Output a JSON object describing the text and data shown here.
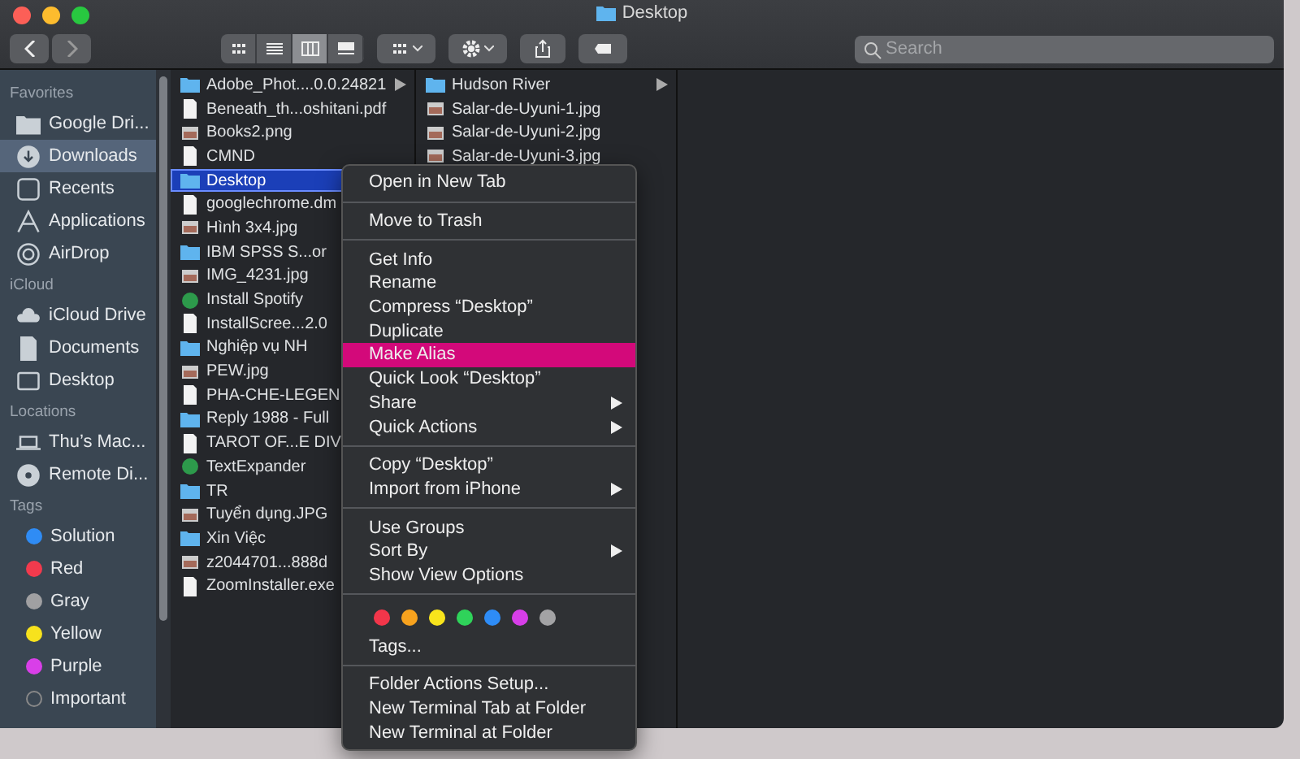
{
  "window": {
    "title": "Desktop"
  },
  "toolbar": {
    "views": [
      {
        "kind": "icons",
        "selected": false
      },
      {
        "kind": "list",
        "selected": false
      },
      {
        "kind": "columns",
        "selected": true
      },
      {
        "kind": "gallery",
        "selected": false
      }
    ],
    "search": {
      "placeholder": "Search"
    }
  },
  "sidebar": {
    "sections": [
      {
        "title": "Favorites",
        "items": [
          {
            "label": "Google Dri...",
            "kind": "folder",
            "selected": false
          },
          {
            "label": "Downloads",
            "kind": "download",
            "selected": true
          },
          {
            "label": "Recents",
            "kind": "recents",
            "selected": false
          },
          {
            "label": "Applications",
            "kind": "apps",
            "selected": false
          },
          {
            "label": "AirDrop",
            "kind": "airdrop",
            "selected": false
          }
        ]
      },
      {
        "title": "iCloud",
        "items": [
          {
            "label": "iCloud Drive",
            "kind": "cloud",
            "selected": false
          },
          {
            "label": "Documents",
            "kind": "document",
            "selected": false
          },
          {
            "label": "Desktop",
            "kind": "desktop",
            "selected": false
          }
        ]
      },
      {
        "title": "Locations",
        "items": [
          {
            "label": "Thu’s Mac...",
            "kind": "laptop",
            "selected": false
          },
          {
            "label": "Remote Di...",
            "kind": "disc",
            "selected": false
          }
        ]
      },
      {
        "title": "Tags",
        "items": [
          {
            "label": "Solution",
            "kind": "tag",
            "color": "#2f8cf5",
            "selected": false
          },
          {
            "label": "Red",
            "kind": "tag",
            "color": "#f23a4d",
            "selected": false
          },
          {
            "label": "Gray",
            "kind": "tag",
            "color": "#a0a0a2",
            "selected": false
          },
          {
            "label": "Yellow",
            "kind": "tag",
            "color": "#f7e21d",
            "selected": false
          },
          {
            "label": "Purple",
            "kind": "tag",
            "color": "#d93fe8",
            "selected": false
          },
          {
            "label": "Important",
            "kind": "tag-empty",
            "selected": false
          }
        ]
      }
    ]
  },
  "columns": [
    {
      "items": [
        {
          "name": "Adobe_Phot....0.0.24821",
          "kind": "folder",
          "arrow": true,
          "selected": false
        },
        {
          "name": "Beneath_th...oshitani.pdf",
          "kind": "document",
          "arrow": false,
          "selected": false
        },
        {
          "name": "Books2.png",
          "kind": "image",
          "arrow": false,
          "selected": false
        },
        {
          "name": "CMND",
          "kind": "document",
          "arrow": false,
          "selected": false
        },
        {
          "name": "Desktop",
          "kind": "folder",
          "arrow": false,
          "selected": true
        },
        {
          "name": "googlechrome.dm",
          "kind": "document",
          "arrow": false,
          "selected": false
        },
        {
          "name": "Hình 3x4.jpg",
          "kind": "image",
          "arrow": false,
          "selected": false
        },
        {
          "name": "IBM SPSS S...or",
          "kind": "folder",
          "arrow": false,
          "selected": false
        },
        {
          "name": "IMG_4231.jpg",
          "kind": "image",
          "arrow": false,
          "selected": false
        },
        {
          "name": "Install Spotify",
          "kind": "app",
          "arrow": false,
          "selected": false
        },
        {
          "name": "InstallScree...2.0",
          "kind": "document",
          "arrow": false,
          "selected": false
        },
        {
          "name": "Nghiệp vụ NH",
          "kind": "folder",
          "arrow": false,
          "selected": false
        },
        {
          "name": "PEW.jpg",
          "kind": "image",
          "arrow": false,
          "selected": false
        },
        {
          "name": "PHA-CHE-LEGEN",
          "kind": "document",
          "arrow": false,
          "selected": false
        },
        {
          "name": "Reply 1988 - Full",
          "kind": "folder",
          "arrow": false,
          "selected": false
        },
        {
          "name": "TAROT OF...E DIV",
          "kind": "document",
          "arrow": false,
          "selected": false
        },
        {
          "name": "TextExpander",
          "kind": "app",
          "arrow": false,
          "selected": false
        },
        {
          "name": "TR",
          "kind": "folder",
          "arrow": false,
          "selected": false
        },
        {
          "name": "Tuyển dụng.JPG",
          "kind": "image",
          "arrow": false,
          "selected": false
        },
        {
          "name": "Xin Việc",
          "kind": "folder",
          "arrow": false,
          "selected": false
        },
        {
          "name": "z2044701...888d",
          "kind": "image",
          "arrow": false,
          "selected": false
        },
        {
          "name": "ZoomInstaller.exe",
          "kind": "document",
          "arrow": false,
          "selected": false
        }
      ]
    },
    {
      "items": [
        {
          "name": "Hudson River",
          "kind": "folder",
          "arrow": true,
          "selected": false
        },
        {
          "name": "Salar-de-Uyuni-1.jpg",
          "kind": "image",
          "arrow": false,
          "selected": false
        },
        {
          "name": "Salar-de-Uyuni-2.jpg",
          "kind": "image",
          "arrow": false,
          "selected": false
        },
        {
          "name": "Salar-de-Uyuni-3.jpg",
          "kind": "image",
          "arrow": false,
          "selected": false
        }
      ]
    }
  ],
  "context_menu": {
    "sections": [
      [
        {
          "kind": "text",
          "label": "Open in New Tab",
          "submenu": false,
          "selected": false
        }
      ],
      [
        {
          "kind": "text",
          "label": "Move to Trash",
          "submenu": false,
          "selected": false
        }
      ],
      [
        {
          "kind": "text",
          "label": "Get Info",
          "submenu": false,
          "selected": false
        },
        {
          "kind": "text",
          "label": "Rename",
          "submenu": false,
          "selected": false
        },
        {
          "kind": "text",
          "label": "Compress “Desktop”",
          "submenu": false,
          "selected": false
        },
        {
          "kind": "text",
          "label": "Duplicate",
          "submenu": false,
          "selected": false
        },
        {
          "kind": "text",
          "label": "Make Alias",
          "submenu": false,
          "selected": true
        },
        {
          "kind": "text",
          "label": "Quick Look “Desktop”",
          "submenu": false,
          "selected": false
        },
        {
          "kind": "text",
          "label": "Share",
          "submenu": true,
          "selected": false
        },
        {
          "kind": "text",
          "label": "Quick Actions",
          "submenu": true,
          "selected": false
        }
      ],
      [
        {
          "kind": "text",
          "label": "Copy “Desktop”",
          "submenu": false,
          "selected": false
        },
        {
          "kind": "text",
          "label": "Import from iPhone",
          "submenu": true,
          "selected": false
        }
      ],
      [
        {
          "kind": "text",
          "label": "Use Groups",
          "submenu": false,
          "selected": false
        },
        {
          "kind": "text",
          "label": "Sort By",
          "submenu": true,
          "selected": false
        },
        {
          "kind": "text",
          "label": "Show View Options",
          "submenu": false,
          "selected": false
        }
      ],
      [
        {
          "kind": "colors",
          "colors": [
            {
              "color": "#f2364a"
            },
            {
              "color": "#f7a21e"
            },
            {
              "color": "#f8e41c"
            },
            {
              "color": "#2fd35a"
            },
            {
              "color": "#2e8cf6"
            },
            {
              "color": "#d73ee8"
            },
            {
              "color": "#a3a3a5"
            }
          ]
        },
        {
          "kind": "text",
          "label": "Tags...",
          "submenu": false,
          "selected": false
        }
      ],
      [
        {
          "kind": "text",
          "label": "Folder Actions Setup...",
          "submenu": false,
          "selected": false
        },
        {
          "kind": "text",
          "label": "New Terminal Tab at Folder",
          "submenu": false,
          "selected": false
        },
        {
          "kind": "text",
          "label": "New Terminal at Folder",
          "submenu": false,
          "selected": false
        }
      ]
    ]
  }
}
